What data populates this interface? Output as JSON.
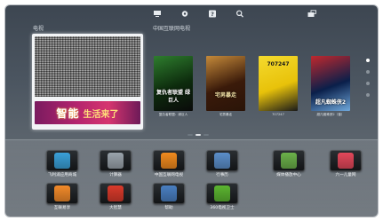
{
  "topbar": {
    "icons": [
      "media-icon",
      "settings-gear-icon",
      "help-icon",
      "search-icon",
      "switch-screen-icon"
    ]
  },
  "tv": {
    "section_label": "电视",
    "banner_text_big": "智能",
    "banner_text_small": "生活来了"
  },
  "internet_tv": {
    "section_label": "中国互联网电视",
    "posters": [
      {
        "caption": "复仇者联盟：绿巨人",
        "art_text": "复仇者联盟 绿巨人",
        "colors": [
          "#0d2b0d",
          "#2e7d2e",
          "#0a0a0a"
        ]
      },
      {
        "caption": "宅男暴走",
        "art_text": "宅男暴走",
        "colors": [
          "#3a1a0a",
          "#c58a3a",
          "#2a1408"
        ]
      },
      {
        "caption": "707247",
        "art_text": "707247",
        "colors": [
          "#e8c20a",
          "#f4da2e",
          "#1a1a1a"
        ]
      },
      {
        "caption": "超凡蜘蛛侠2（普）",
        "art_text": "超凡蜘蛛侠2",
        "colors": [
          "#0a1f4a",
          "#c0282d",
          "#6fa8dc"
        ]
      }
    ]
  },
  "apps": [
    {
      "label": "飞利浦应用商城",
      "icon": "app-store-icon",
      "color": "#3aa0d8"
    },
    {
      "label": "计算器",
      "icon": "calculator-icon",
      "color": "#9aa3ab"
    },
    {
      "label": "中国互联网电视",
      "icon": "internet-tv-icon",
      "color": "#f08a1e"
    },
    {
      "label": "行事历",
      "icon": "calendar-icon",
      "color": "#5b8ec9"
    },
    {
      "label": "媒体播放中心",
      "icon": "media-center-icon",
      "color": "#6bb04a"
    },
    {
      "label": "六一儿童网",
      "icon": "kids-net-icon",
      "color": "#e2485a"
    },
    {
      "label": "互联易享",
      "icon": "share-icon",
      "color": "#f28a2a"
    },
    {
      "label": "大智慧",
      "icon": "stock-app-icon",
      "color": "#d93a2b"
    },
    {
      "label": "帮助",
      "icon": "help-book-icon",
      "color": "#4a7fc1"
    },
    {
      "label": "360电视卫士",
      "icon": "tv-guard-icon",
      "color": "#5cb531"
    }
  ]
}
